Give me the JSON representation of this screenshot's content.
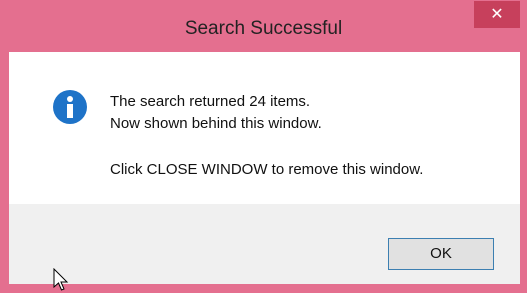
{
  "window": {
    "title": "Search Successful",
    "close_label": "✕"
  },
  "message": {
    "line1": "The search returned 24 items.",
    "line2": "Now shown behind this window.",
    "line3": "Click CLOSE WINDOW to remove this window."
  },
  "buttons": {
    "ok_label": "OK"
  },
  "icons": {
    "message_icon": "info-icon",
    "cursor": "mouse-pointer-icon"
  },
  "colors": {
    "frame": "#e46f8f",
    "close_button": "#c7405c",
    "info_icon": "#1e73c8",
    "button_border": "#3c7fb1"
  }
}
